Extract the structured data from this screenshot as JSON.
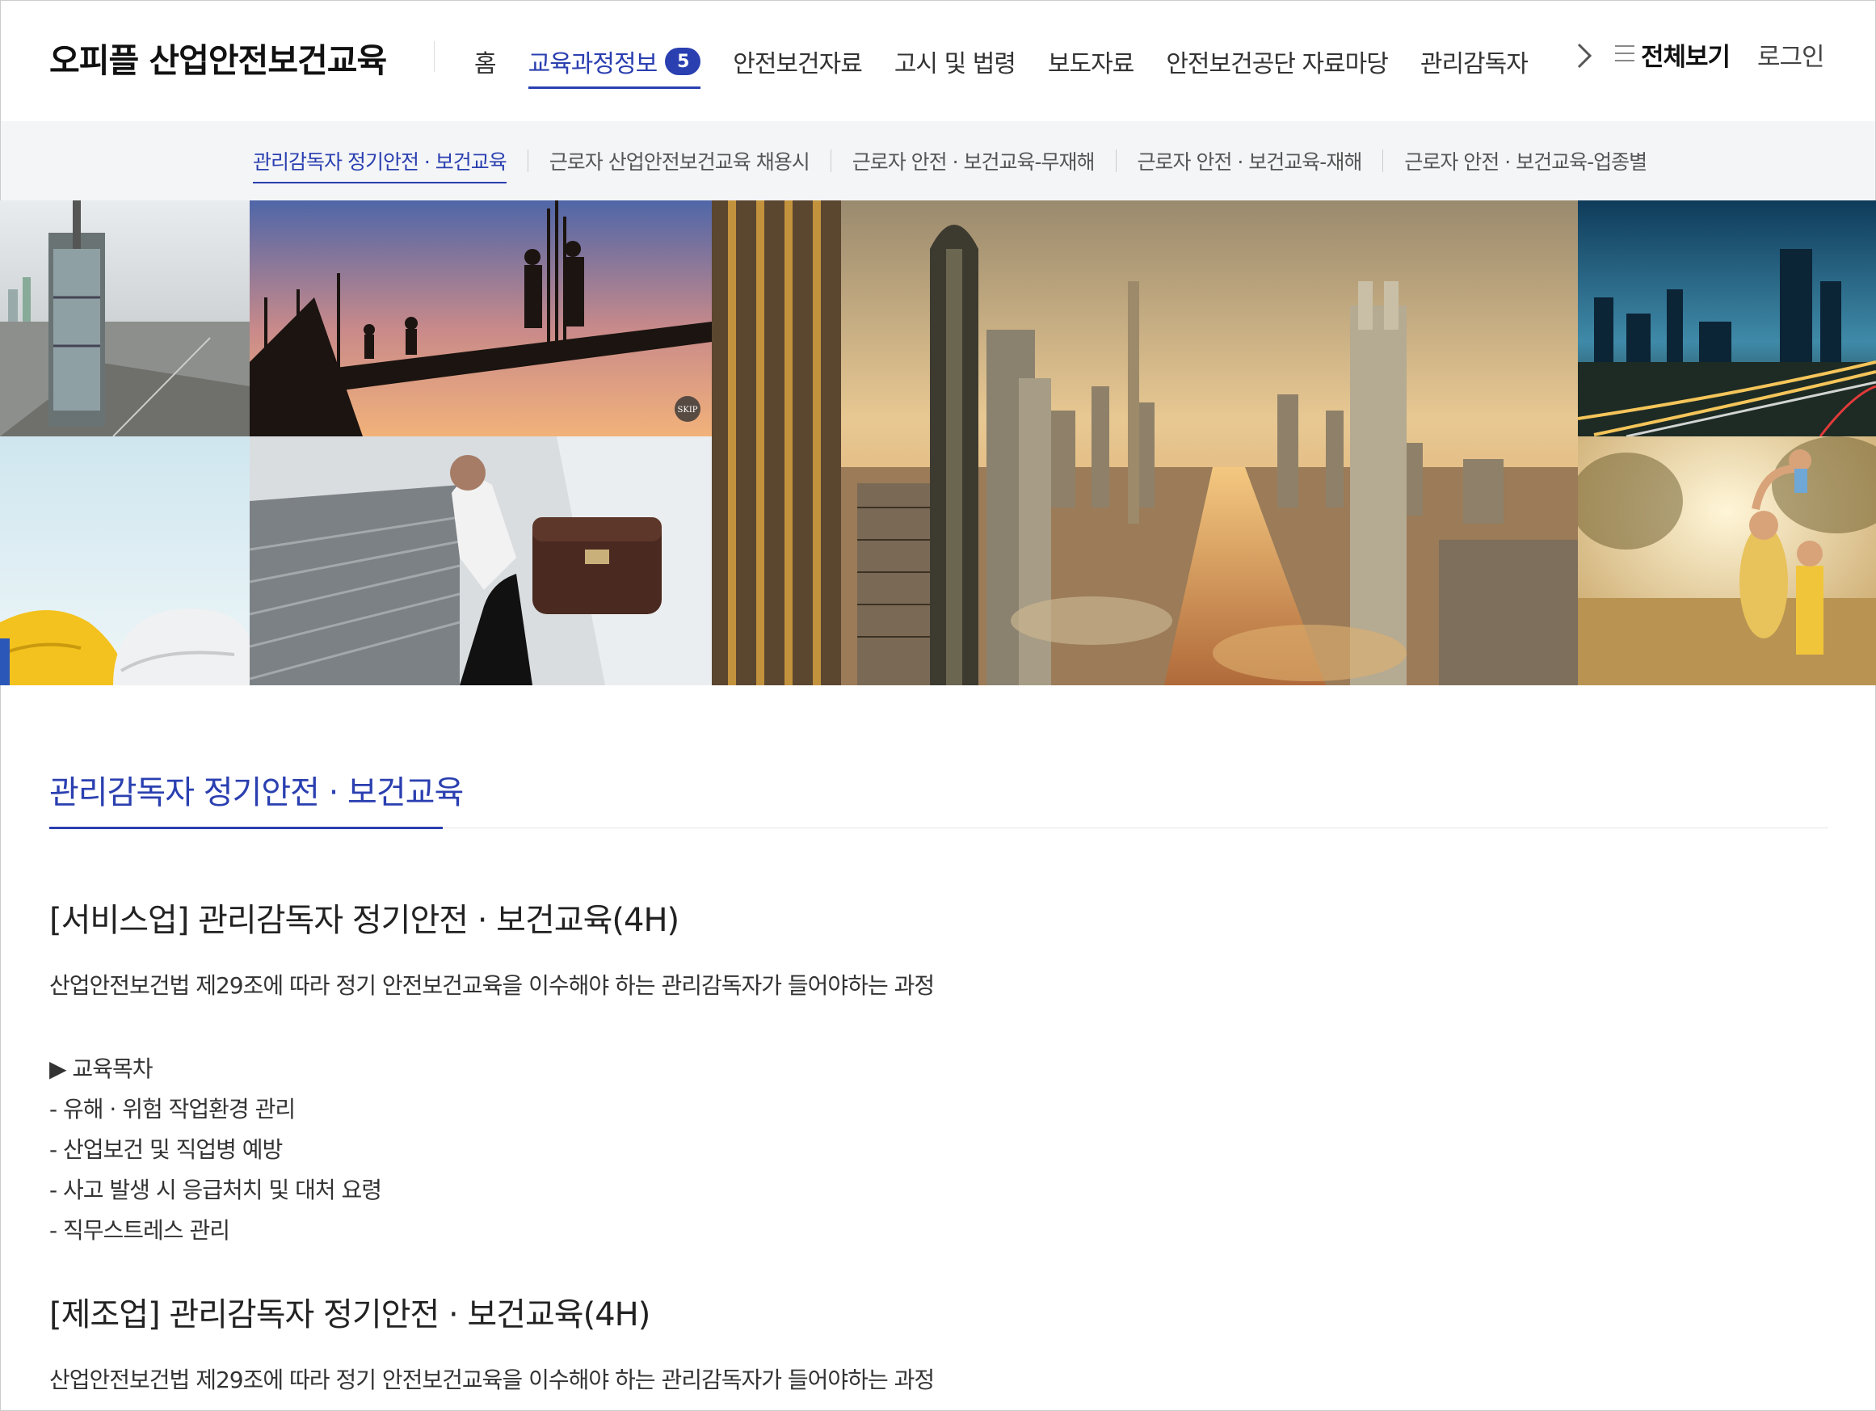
{
  "header": {
    "logo": "오피플 산업안전보건교육",
    "nav": [
      {
        "label": "홈",
        "active": false
      },
      {
        "label": "교육과정정보",
        "active": true,
        "badge": "5"
      },
      {
        "label": "안전보건자료",
        "active": false
      },
      {
        "label": "고시 및 법령",
        "active": false
      },
      {
        "label": "보도자료",
        "active": false
      },
      {
        "label": "안전보건공단 자료마당",
        "active": false
      },
      {
        "label": "관리감독자",
        "active": false
      }
    ],
    "next_icon": "chevron-right-icon",
    "all_view": {
      "icon": "hamburger-menu-icon",
      "label": "전체보기"
    },
    "login": "로그인"
  },
  "subnav": [
    {
      "label": "관리감독자 정기안전 · 보건교육",
      "active": true
    },
    {
      "label": "근로자 산업안전보건교육 채용시",
      "active": false
    },
    {
      "label": "근로자 안전 · 보건교육-무재해",
      "active": false
    },
    {
      "label": "근로자 안전 · 보건교육-재해",
      "active": false
    },
    {
      "label": "근로자 안전 · 보건교육-업종별",
      "active": false
    }
  ],
  "banner": {
    "skip_label": "SKIP",
    "tiles": [
      "city-tower",
      "workers-silhouette",
      "safety-helmets",
      "businessman-briefcase",
      "city-skyline-sunset",
      "night-highway",
      "family-field"
    ]
  },
  "main": {
    "page_title": "관리감독자 정기안전 · 보건교육",
    "courses": [
      {
        "title": "[서비스업] 관리감독자 정기안전 · 보건교육(4H)",
        "description": "산업안전보건법 제29조에 따라 정기 안전보건교육을 이수해야 하는 관리감독자가 들어야하는 과정",
        "toc_heading": "▶ 교육목차",
        "toc_items": [
          "- 유해 · 위험 작업환경 관리",
          "- 산업보건 및 직업병 예방",
          "- 사고 발생 시 응급처치 및 대처 요령",
          "- 직무스트레스 관리"
        ]
      },
      {
        "title": "[제조업] 관리감독자 정기안전 · 보건교육(4H)",
        "description": "산업안전보건법 제29조에 따라 정기 안전보건교육을 이수해야 하는 관리감독자가 들어야하는 과정"
      }
    ]
  },
  "colors": {
    "accent": "#2a3fb0",
    "subnav_bg": "#f4f5f7"
  }
}
